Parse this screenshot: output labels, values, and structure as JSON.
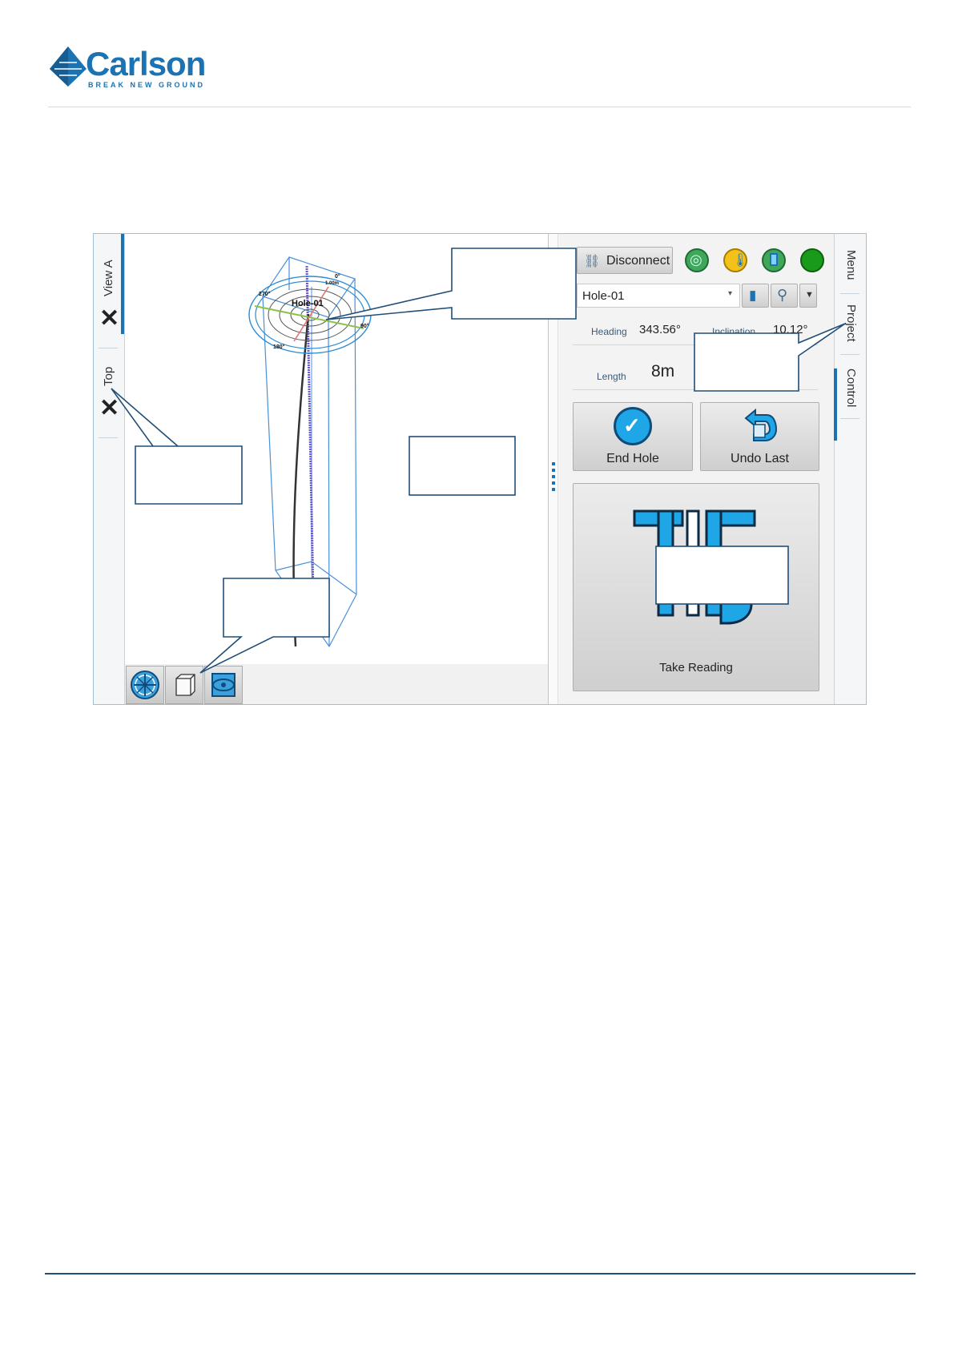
{
  "header": {
    "brand": "Carlson",
    "tagline": "BREAK NEW GROUND"
  },
  "colors": {
    "brand_blue": "#1b73b3",
    "footer_rule": "#1f4e79",
    "status_green": "#1a9a1a",
    "button_blue": "#1ea6e6"
  },
  "left_tabs": {
    "view_a": "View A",
    "top": "Top"
  },
  "view": {
    "hole_label": "Hole-01",
    "compass": {
      "north": "0°",
      "east": "90°",
      "south": "180°",
      "west": "270°",
      "scale": "1.00m"
    },
    "toolbar": [
      "compass-view-icon",
      "box-view-icon",
      "orbit-view-icon"
    ]
  },
  "panel": {
    "disconnect_label": "Disconnect",
    "status_icons": [
      "orbit-icon",
      "thermometer-icon",
      "battery-icon",
      "connection-status-icon"
    ],
    "hole_select": "Hole-01",
    "heading_label": "Heading",
    "heading_value": "343.56°",
    "inclination_label": "Inclination",
    "inclination_value": "10.12°",
    "length_label": "Length",
    "length_value": "8m",
    "end_hole_label": "End Hole",
    "undo_last_label": "Undo Last",
    "take_reading_label": "Take Reading"
  },
  "right_tabs": {
    "menu": "Menu",
    "project": "Project",
    "control": "Control"
  }
}
